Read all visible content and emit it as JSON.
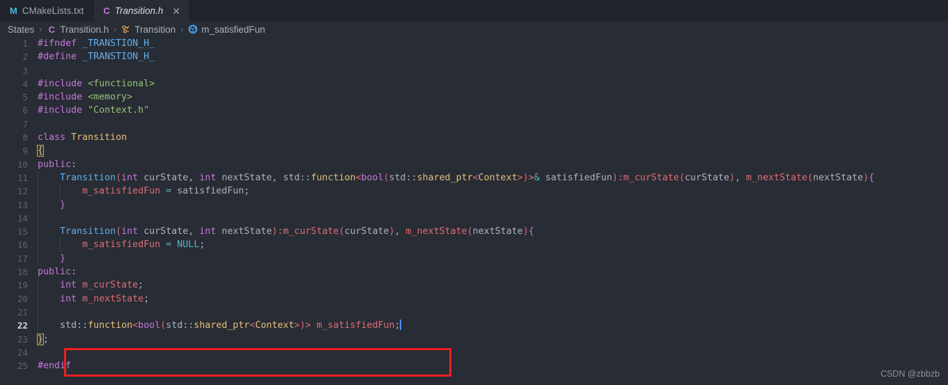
{
  "window": {
    "background": "#282c34",
    "tabbar_background": "#21252b"
  },
  "tabs": [
    {
      "label": "CMakeLists.txt",
      "icon": "cmake-m-icon",
      "icon_char": "M",
      "active": false,
      "closable": false
    },
    {
      "label": "Transition.h",
      "icon": "cpp-header-c-icon",
      "icon_char": "C",
      "active": true,
      "closable": true,
      "close_char": "✕"
    }
  ],
  "breadcrumb": {
    "separator": "›",
    "items": [
      {
        "label": "States",
        "icon": null
      },
      {
        "label": "Transition.h",
        "icon": "cpp-header-c-icon",
        "icon_char": "C"
      },
      {
        "label": "Transition",
        "icon": "class-icon"
      },
      {
        "label": "m_satisfiedFun",
        "icon": "field-cube-icon"
      }
    ]
  },
  "editor": {
    "language": "cpp",
    "active_line": 22,
    "caret_line": 22,
    "lines": [
      {
        "n": 1,
        "text": "#ifndef _TRANSTION_H_"
      },
      {
        "n": 2,
        "text": "#define _TRANSTION_H_"
      },
      {
        "n": 3,
        "text": ""
      },
      {
        "n": 4,
        "text": "#include <functional>"
      },
      {
        "n": 5,
        "text": "#include <memory>"
      },
      {
        "n": 6,
        "text": "#include \"Context.h\""
      },
      {
        "n": 7,
        "text": ""
      },
      {
        "n": 8,
        "text": "class Transition"
      },
      {
        "n": 9,
        "text": "{"
      },
      {
        "n": 10,
        "text": "public:"
      },
      {
        "n": 11,
        "text": "    Transition(int curState, int nextState, std::function<bool(std::shared_ptr<Context>)>& satisfiedFun):m_curState(curState), m_nextState(nextState){"
      },
      {
        "n": 12,
        "text": "        m_satisfiedFun = satisfiedFun;"
      },
      {
        "n": 13,
        "text": "    }"
      },
      {
        "n": 14,
        "text": ""
      },
      {
        "n": 15,
        "text": "    Transition(int curState, int nextState):m_curState(curState), m_nextState(nextState){"
      },
      {
        "n": 16,
        "text": "        m_satisfiedFun = NULL;"
      },
      {
        "n": 17,
        "text": "    }"
      },
      {
        "n": 18,
        "text": "public:"
      },
      {
        "n": 19,
        "text": "    int m_curState;"
      },
      {
        "n": 20,
        "text": "    int m_nextState;"
      },
      {
        "n": 21,
        "text": ""
      },
      {
        "n": 22,
        "text": "    std::function<bool(std::shared_ptr<Context>)> m_satisfiedFun;"
      },
      {
        "n": 23,
        "text": "};"
      },
      {
        "n": 24,
        "text": ""
      },
      {
        "n": 25,
        "text": "#endif"
      }
    ]
  },
  "annotation": {
    "type": "rectangle",
    "color": "#ef2020",
    "covers_lines": [
      22,
      23
    ]
  },
  "watermark": {
    "text": "CSDN @zbbzb"
  },
  "colors": {
    "background": "#282c34",
    "gutter_text": "#5c6370",
    "keyword": "#c678dd",
    "type": "#e5c07b",
    "function": "#61afef",
    "string": "#98c379",
    "member": "#e06c75",
    "identifier": "#abb2bf",
    "operator": "#56b6c2",
    "annotation_red": "#ef2020"
  }
}
